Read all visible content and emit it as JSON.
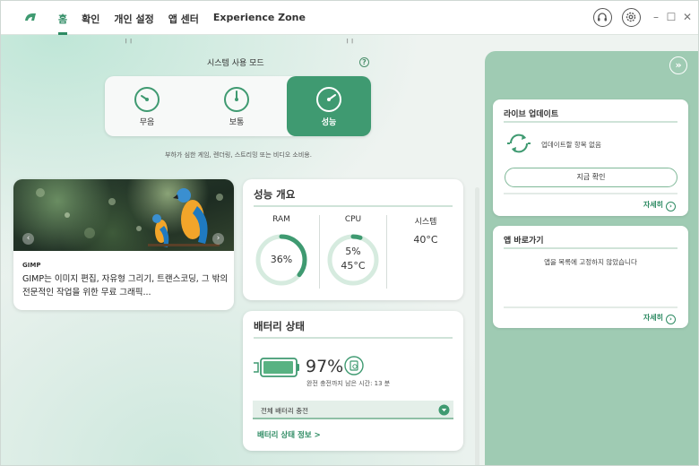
{
  "titlebar": {
    "nav": [
      "홈",
      "확인",
      "개인 설정",
      "앱 센터",
      "Experience Zone"
    ],
    "window_buttons": [
      "–",
      "☐",
      "✕"
    ],
    "icons": [
      "headset-icon",
      "gear-icon"
    ]
  },
  "mode": {
    "title": "시스템 사용 모드",
    "help": "?",
    "options": [
      {
        "label": "무음",
        "active": false
      },
      {
        "label": "보통",
        "active": false
      },
      {
        "label": "성능",
        "active": true
      }
    ],
    "description": "부하가 심한 게임, 렌더링, 스트리밍 또는 비디오 소비용."
  },
  "gimp": {
    "tag": "GIMP",
    "text": "GIMP는 이미지 편집, 자유형 그리기, 트랜스코딩, 그 밖의 전문적인 작업을 위한 무료 그래픽..."
  },
  "performance": {
    "title": "성능 개요",
    "ram_label": "RAM",
    "ram_value": "36%",
    "ram_percent": 36,
    "cpu_label": "CPU",
    "cpu_value": "5%",
    "cpu_percent": 5,
    "cpu_temp": "45°C",
    "system_label": "시스템",
    "system_temp": "40°C"
  },
  "battery": {
    "title": "배터리 상태",
    "value": "97%",
    "percent": 97,
    "sub": "완전 충전까지 남은 시간: 13 분",
    "charge_mode": "전체 배터리 충전",
    "link": "배터리 상태 정보 >"
  },
  "live_update": {
    "title": "라이브 업데이트",
    "status": "업데이트할 항목 없음",
    "button": "지금 확인",
    "more": "자세히"
  },
  "app_shortcut": {
    "title": "앱 바로가기",
    "empty": "앱을 목록에 고정하지 않았습니다",
    "more": "자세히"
  },
  "colors": {
    "accent": "#2e8b63",
    "mode_active": "#3f9a71",
    "right_panel": "#9fcbb3"
  }
}
